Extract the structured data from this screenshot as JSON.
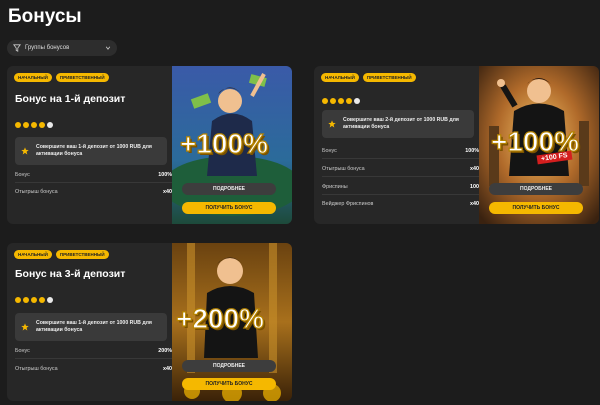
{
  "page": {
    "title": "Бонусы"
  },
  "filter": {
    "label": "Группы бонусов"
  },
  "cards": [
    {
      "badges": [
        "Начальный",
        "Приветственный"
      ],
      "title": "Бонус на 1-й депозит",
      "stars_total": 5,
      "stars_filled": 4,
      "info": "Совершите ваш 1-й депозит от 1000 RUB для активации бонуса",
      "rows": [
        {
          "label": "Бонус",
          "value": "100%"
        },
        {
          "label": "Отыгрыш бонуса",
          "value": "x40"
        }
      ],
      "promo": "+100%",
      "more_label": "Подробнее",
      "get_label": "Получить бонус"
    },
    {
      "badges": [
        "Начальный",
        "Приветственный"
      ],
      "title": "",
      "stars_total": 5,
      "stars_filled": 4,
      "info": "Совершите ваш 2-й депозит от 1000 RUB для активации бонуса",
      "rows": [
        {
          "label": "Бонус",
          "value": "100%"
        },
        {
          "label": "Отыгрыш бонуса",
          "value": "x40"
        },
        {
          "label": "Фриспины",
          "value": "100"
        },
        {
          "label": "Вейджер Фриспинов",
          "value": "x40"
        }
      ],
      "promo": "+100%",
      "promo_fs": "+100 FS",
      "more_label": "Подробнее",
      "get_label": "Получить бонус"
    },
    {
      "badges": [
        "Начальный",
        "Приветственный"
      ],
      "title": "Бонус на 3-й депозит",
      "stars_total": 5,
      "stars_filled": 4,
      "info": "Совершите ваш 1-й депозит от 1000 RUB для активации бонуса",
      "rows": [
        {
          "label": "Бонус",
          "value": "200%"
        },
        {
          "label": "Отыгрыш бонуса",
          "value": "x40"
        }
      ],
      "promo": "+200%",
      "more_label": "Подробнее",
      "get_label": "Получить бонус"
    }
  ],
  "colors": {
    "accent": "#f5b800",
    "background": "#1c1c1c",
    "card": "#272727"
  }
}
